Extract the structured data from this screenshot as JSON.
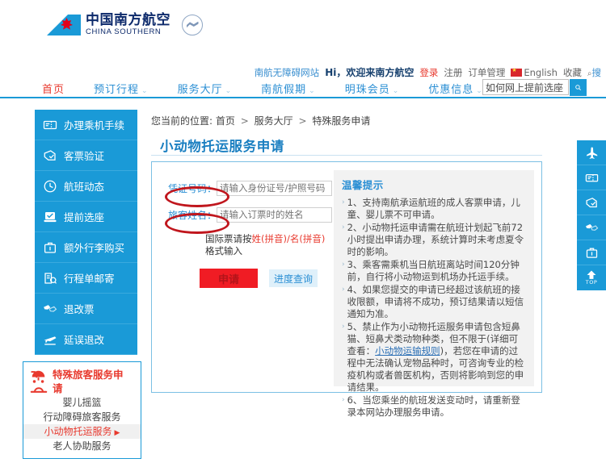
{
  "brand": {
    "name_cn": "中国南方航空",
    "name_en": "CHINA SOUTHERN",
    "alliance": "SKYTEAM"
  },
  "utility": {
    "accessible_site": "南航无障碍网站",
    "greeting": "Hi，欢迎来南方航空",
    "login": "登录",
    "register": "注册",
    "orders": "订单管理",
    "language": "English",
    "favorite": "收藏",
    "search_link": "搜"
  },
  "mainnav": {
    "items": [
      {
        "label": "首页",
        "active": true,
        "caret": false
      },
      {
        "label": "预订行程",
        "active": false,
        "caret": true
      },
      {
        "label": "服务大厅",
        "active": false,
        "caret": true
      },
      {
        "label": "南航假期",
        "active": false,
        "caret": true
      },
      {
        "label": "明珠会员",
        "active": false,
        "caret": true
      },
      {
        "label": "优惠信息",
        "active": false,
        "caret": true
      }
    ],
    "caret_glyph": "⌄"
  },
  "navsearch": {
    "value": "如何网上提前选座",
    "placeholder": "如何网上提前选座",
    "button_icon": "search-icon"
  },
  "sidebar": {
    "items": [
      {
        "label": "办理乘机手续",
        "icon": "boarding-pass-icon"
      },
      {
        "label": "客票验证",
        "icon": "ticket-verify-icon"
      },
      {
        "label": "航班动态",
        "icon": "clock-icon"
      },
      {
        "label": "提前选座",
        "icon": "seat-select-icon"
      },
      {
        "label": "额外行李购买",
        "icon": "luggage-icon"
      },
      {
        "label": "行程单邮寄",
        "icon": "itinerary-mail-icon"
      },
      {
        "label": "退改票",
        "icon": "refund-ticket-icon"
      },
      {
        "label": "延误退改",
        "icon": "delay-change-icon"
      }
    ]
  },
  "special_panel": {
    "title": "特殊旅客服务申请",
    "sub_items": [
      {
        "label": "婴儿摇篮",
        "active": false
      },
      {
        "label": "行动障碍旅客服务",
        "active": false
      },
      {
        "label": "小动物托运服务",
        "active": true
      },
      {
        "label": "老人协助服务",
        "active": false
      }
    ],
    "active_arrow": "▶"
  },
  "breadcrumb": {
    "prefix": "您当前的位置:",
    "items": [
      "首页",
      "服务大厅",
      "特殊服务申请"
    ],
    "separator": ">"
  },
  "page": {
    "title": "小动物托运服务申请"
  },
  "form": {
    "cert_label": "凭证号码：",
    "cert_placeholder": "请输入身份证号/护照号码",
    "cert_value": "",
    "name_label": "旅客姓名：",
    "name_placeholder": "请输入订票时的姓名",
    "name_value": "",
    "hint_prefix": "国际票请按",
    "hint_highlight": "姓(拼音)/名(拼音)",
    "hint_suffix": "格式输入",
    "apply_button": "申请",
    "progress_button": "进度查询"
  },
  "tips": {
    "title": "温馨提示",
    "bullet": "›",
    "items": [
      {
        "text": "1、支持南航承运航班的成人客票申请，儿童、婴儿票不可申请。"
      },
      {
        "text": "2、小动物托运申请需在航班计划起飞前72小时提出申请办理，系统计算时未考虑夏令时的影响。"
      },
      {
        "text": "3、乘客需乘机当日航班离站时间120分钟前，自行将小动物运到机场办托运手续。"
      },
      {
        "text": "4、如果您提交的申请已经超过该航班的接收限额，申请将不成功，预订结果请以短信通知为准。"
      },
      {
        "pre": "5、禁止作为小动物托运服务申请包含短鼻猫、短鼻犬类动物种类，但不限于(详细可查看：",
        "link": "小动物运输规则",
        "post": ")，若您在申请的过程中无法确认宠物品种时，可咨询专业的检疫机构或者兽医机构，否则将影响到您的申请结果。"
      },
      {
        "text": "6、当您乘坐的航班发送变动时，请重新登录本网站办理服务申请。"
      }
    ]
  },
  "floatbar": {
    "items": [
      {
        "icon": "airplane-icon",
        "label": ""
      },
      {
        "icon": "boarding-pass-icon",
        "label": ""
      },
      {
        "icon": "ticket-verify-icon",
        "label": ""
      },
      {
        "icon": "refund-ticket-icon",
        "label": ""
      },
      {
        "icon": "luggage-icon",
        "label": ""
      },
      {
        "icon": "arrow-up-icon",
        "label": "TOP"
      }
    ]
  },
  "colors": {
    "brand_blue": "#1a9ad7",
    "brand_red": "#e8392e",
    "nav_link": "#2b8fd4",
    "annotation_red": "#c0161d",
    "apply_button_bg": "#f01c24"
  }
}
